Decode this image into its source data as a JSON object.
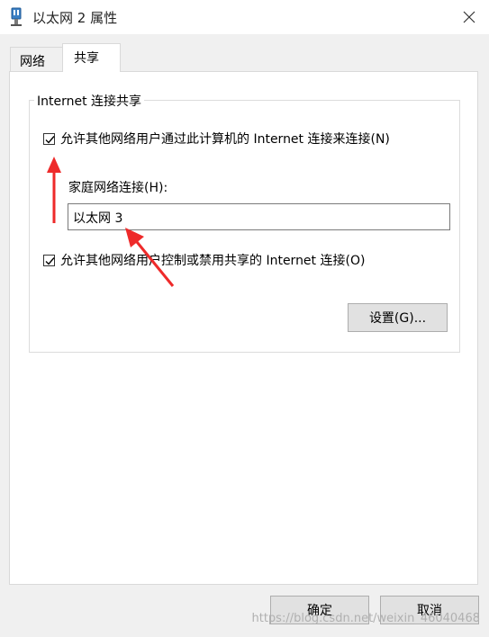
{
  "window": {
    "title": "以太网 2 属性",
    "icon": "network-adapter-icon",
    "close_icon": "close-icon"
  },
  "tabs": [
    {
      "label": "网络",
      "active": false
    },
    {
      "label": "共享",
      "active": true
    }
  ],
  "group": {
    "title": "Internet 连接共享",
    "allow_connect": {
      "label": "允许其他网络用户通过此计算机的 Internet 连接来连接(N)",
      "checked": true
    },
    "home_connection": {
      "label": "家庭网络连接(H):",
      "value": "以太网 3"
    },
    "allow_control": {
      "label": "允许其他网络用户控制或禁用共享的 Internet 连接(O)",
      "checked": true
    },
    "settings_button": "设置(G)..."
  },
  "footer": {
    "ok": "确定",
    "cancel": "取消"
  },
  "annotations": {
    "arrow_color": "#ee2a2a"
  },
  "watermark": "https://blog.csdn.net/weixin_46040468"
}
